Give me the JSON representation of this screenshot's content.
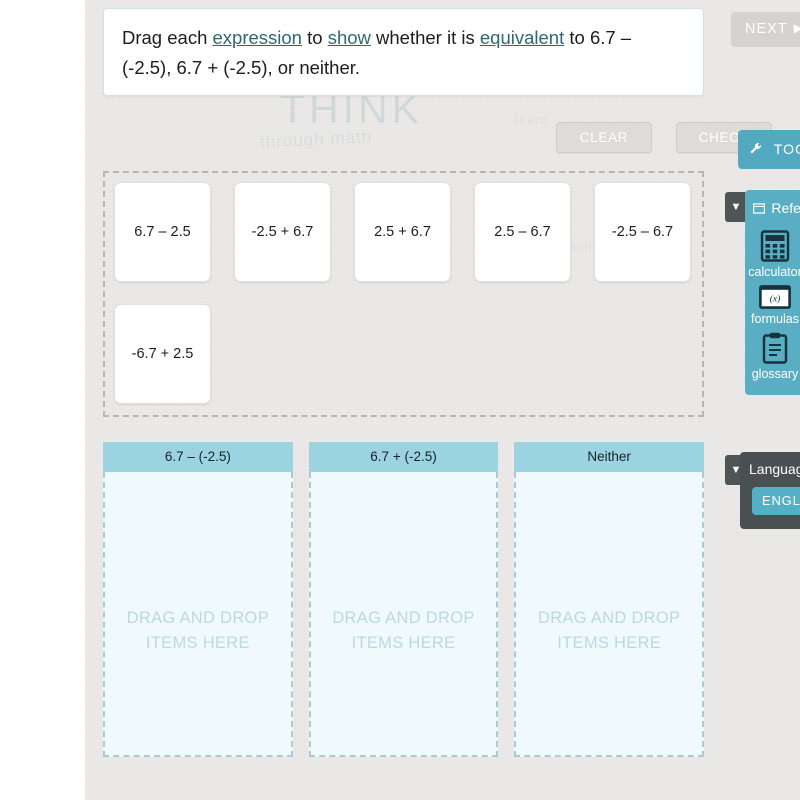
{
  "instruction": {
    "segments": [
      {
        "text": "Drag each ",
        "link": false
      },
      {
        "text": "expression",
        "link": true
      },
      {
        "text": " to ",
        "link": false
      },
      {
        "text": "show",
        "link": true
      },
      {
        "text": " whether it is ",
        "link": false
      },
      {
        "text": "equivalent",
        "link": true
      },
      {
        "text": " to 6.7 – (-2.5), 6.7 + (-2.5), or neither.",
        "link": false
      }
    ]
  },
  "toolbar": {
    "clear_label": "CLEAR",
    "check_label": "CHECK"
  },
  "tiles": [
    {
      "label": "6.7 – 2.5"
    },
    {
      "label": "-2.5 + 6.7"
    },
    {
      "label": "2.5 + 6.7"
    },
    {
      "label": "2.5 – 6.7"
    },
    {
      "label": "-2.5 – 6.7"
    },
    {
      "label": "-6.7 + 2.5"
    }
  ],
  "dropzones": [
    {
      "header": "6.7 – (-2.5)",
      "placeholder": "DRAG AND DROP ITEMS HERE"
    },
    {
      "header": "6.7 + (-2.5)",
      "placeholder": "DRAG AND DROP ITEMS HERE"
    },
    {
      "header": "Neither",
      "placeholder": "DRAG AND DROP ITEMS HERE"
    }
  ],
  "rail": {
    "next_label": "NEXT",
    "next_icon": "play-triangle-icon",
    "tools_label": "TOOLS",
    "tools_icon": "wrench-icon",
    "reference": {
      "title": "Reference",
      "title_icon": "window-icon",
      "collapse_icon": "▼",
      "items": [
        {
          "label": "calculator",
          "icon": "calculator-icon"
        },
        {
          "label": "formulas",
          "icon": "formula-icon"
        },
        {
          "label": "glossary",
          "icon": "clipboard-icon"
        }
      ]
    },
    "language": {
      "title": "Language",
      "collapse_icon": "▼",
      "button_label": "ENGLISH"
    }
  },
  "watermark": {
    "main": "THINK",
    "sub": "through math",
    "faint_a": "learn",
    "faint_b": "practice"
  },
  "colors": {
    "accent_teal": "#53a9c0",
    "header_teal": "#9bd4e0",
    "dropzone_fill": "#f0f9fb",
    "dropzone_border": "#a9ccd4",
    "page_bg": "#eceae8",
    "disabled_gray": "#dedcda",
    "panel_dark": "#4a4f52"
  }
}
